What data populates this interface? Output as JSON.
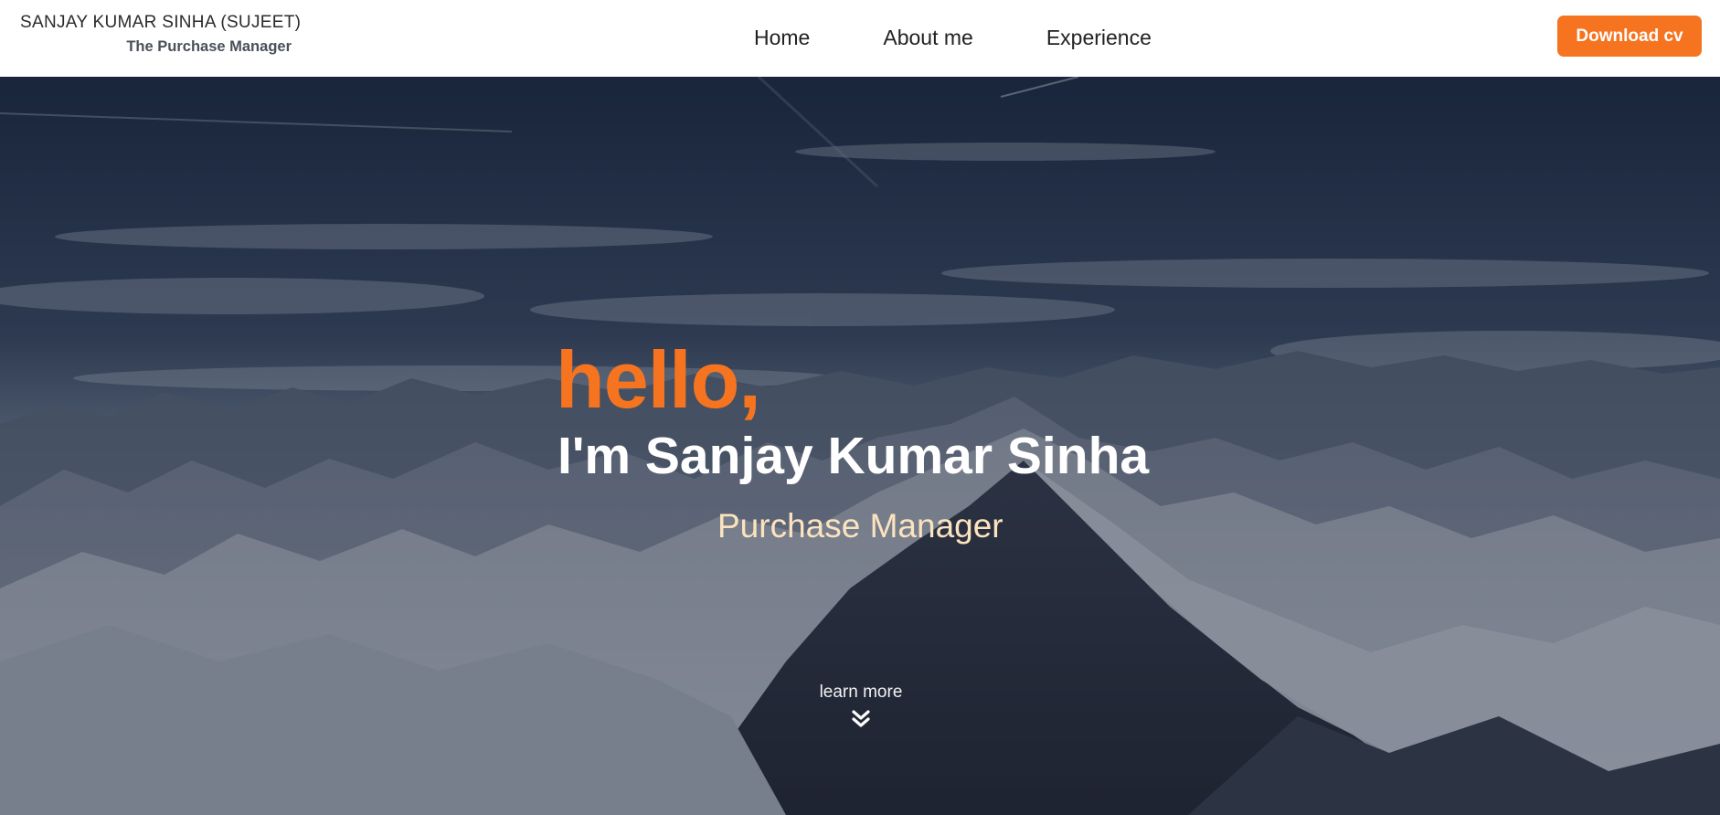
{
  "header": {
    "brand_name": "SANJAY KUMAR SINHA (SUJEET)",
    "brand_subtitle": "The Purchase Manager",
    "nav": [
      {
        "label": "Home"
      },
      {
        "label": "About me"
      },
      {
        "label": "Experience"
      }
    ],
    "cta_label": "Download cv"
  },
  "hero": {
    "greeting": "hello,",
    "headline": "I'm Sanjay Kumar Sinha",
    "role": "Purchase Manager",
    "learn_more": "learn more",
    "scroll_icon": "double-chevron-down-icon"
  },
  "colors": {
    "accent": "#f6741f",
    "role_text": "#fbe3bf",
    "header_bg": "#ffffff"
  }
}
